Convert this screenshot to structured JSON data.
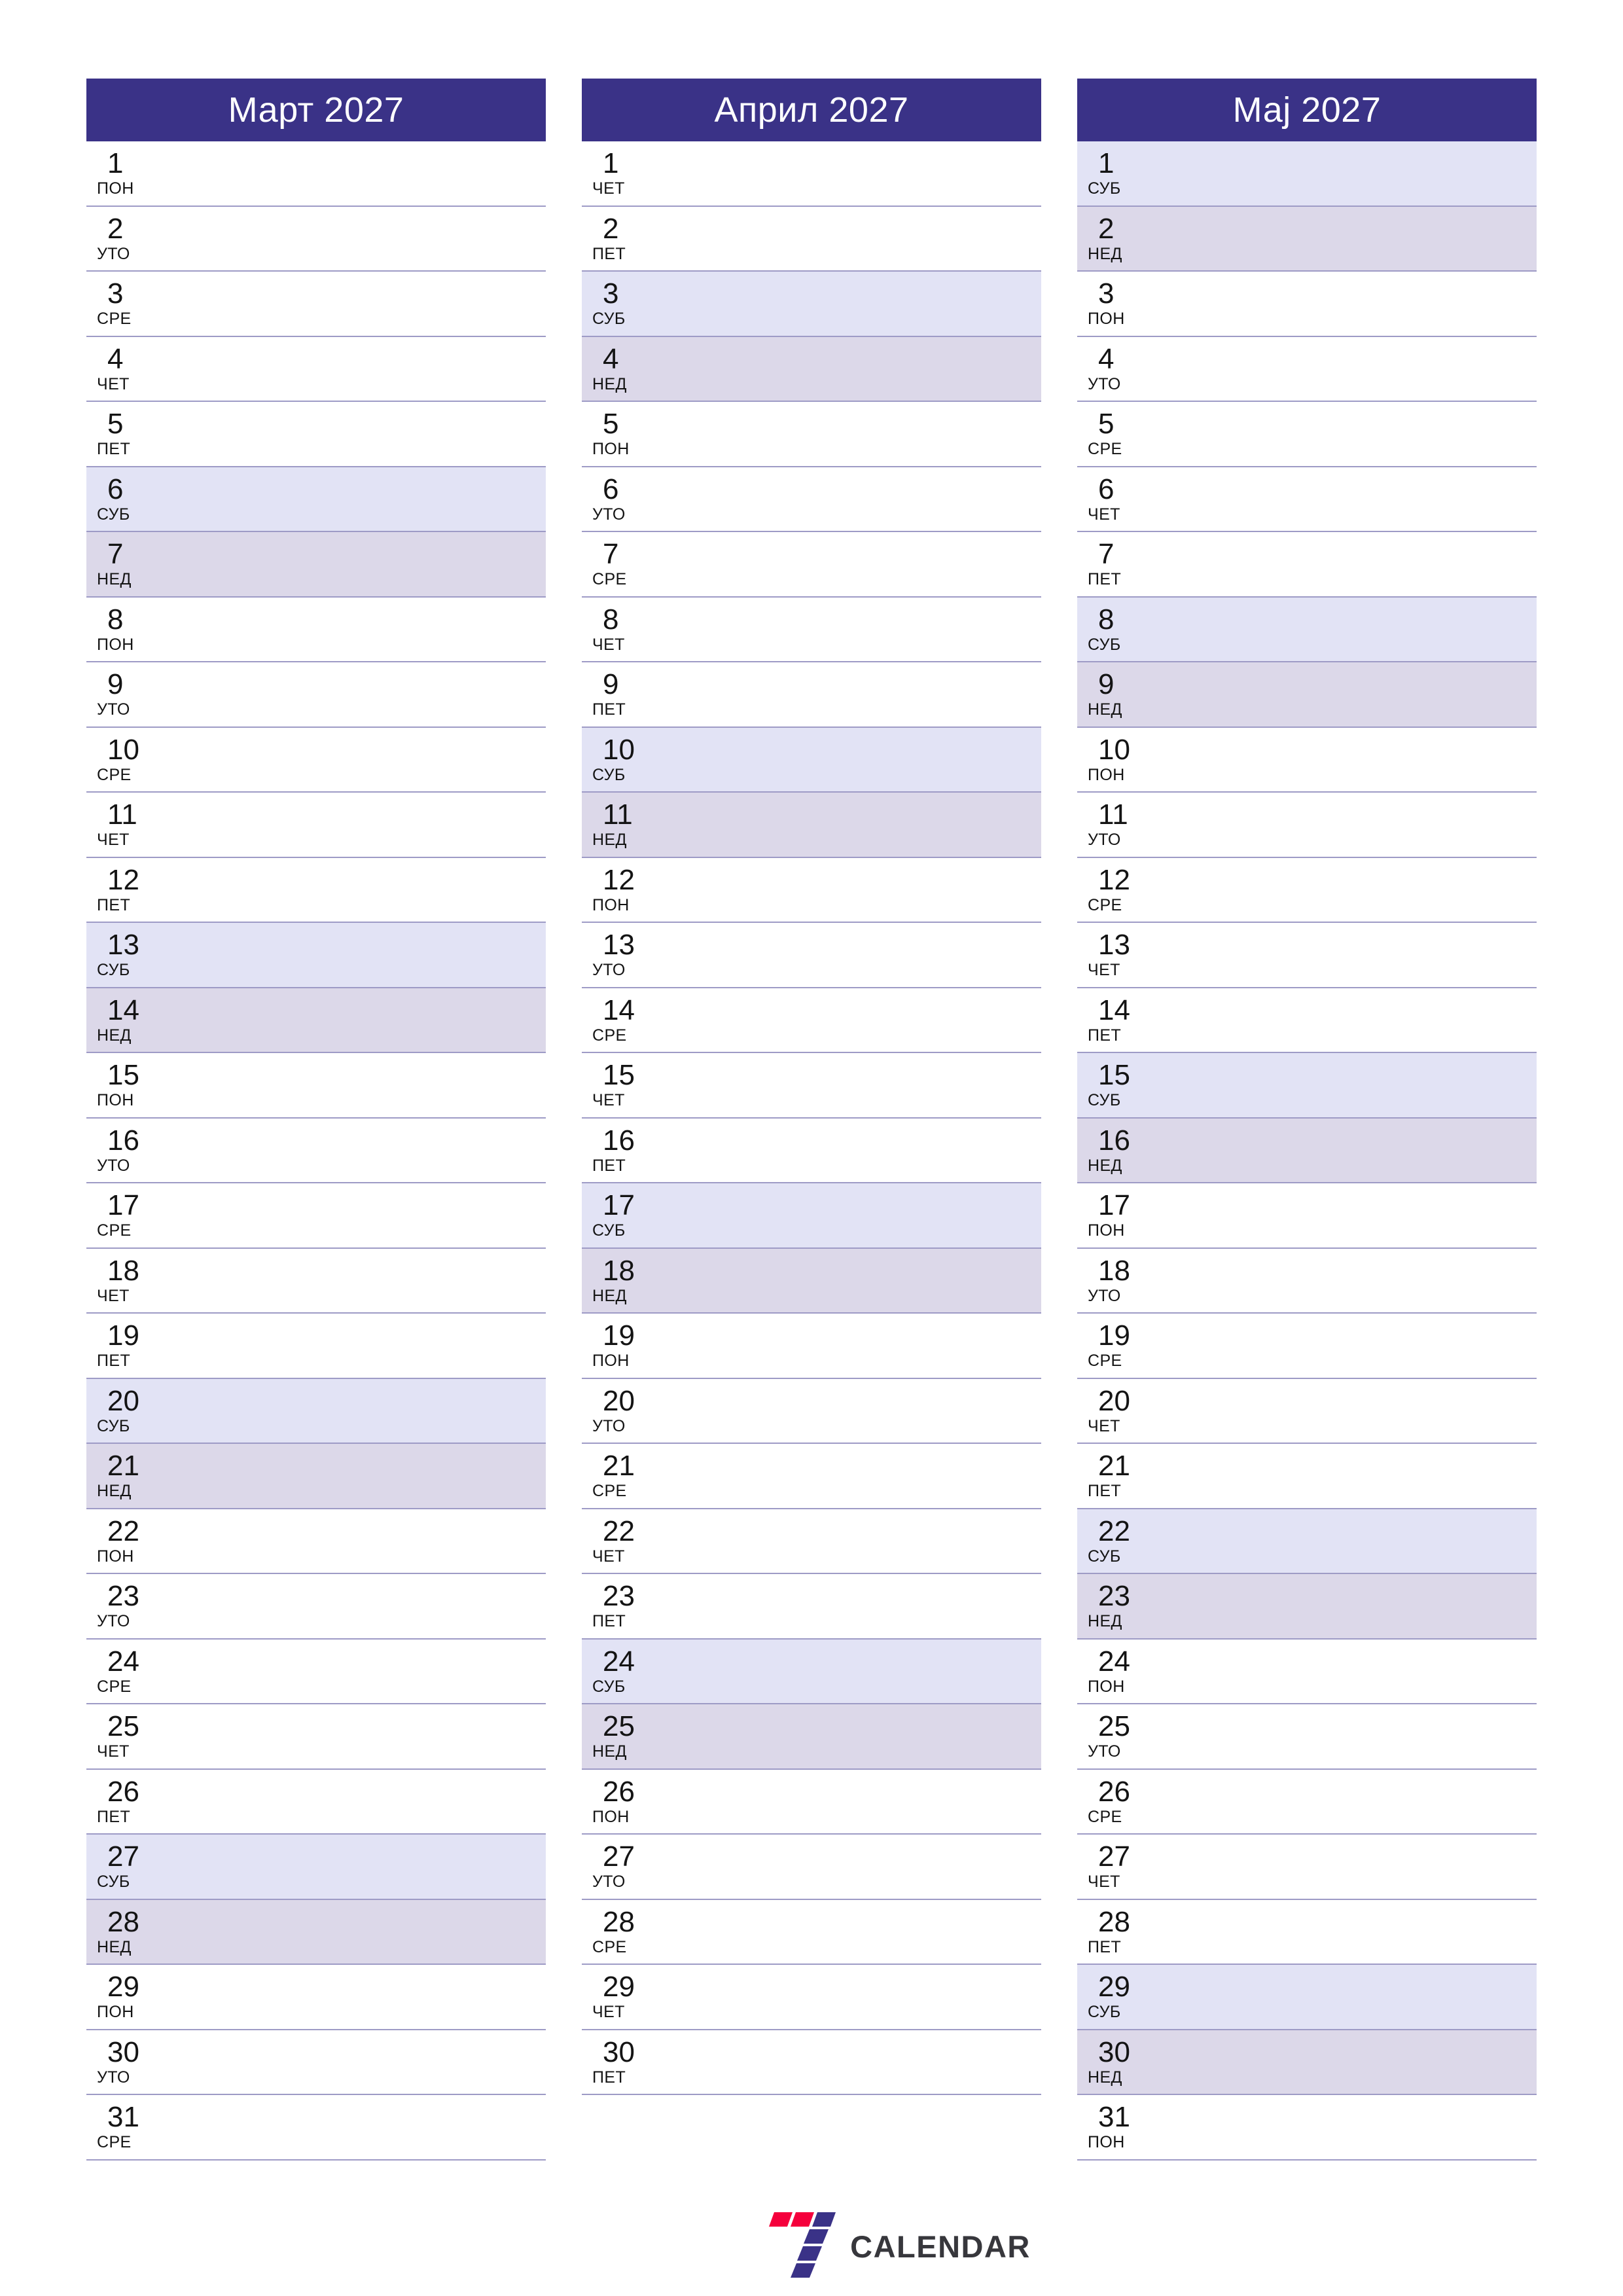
{
  "document": {
    "type": "printable-monthly-planner",
    "locale": "sr",
    "year": "2027"
  },
  "colors": {
    "header_bg": "#3a3287",
    "header_text": "#ffffff",
    "saturday_bg": "#e2e3f5",
    "sunday_bg": "#dcd8e9",
    "row_divider": "#9e9bc6",
    "page_bg": "#ffffff",
    "logo_red": "#f5003c",
    "logo_indigo": "#3a3287",
    "logo_text": "#37373c"
  },
  "logo": {
    "mark": "seven-bars-icon",
    "text": "CALENDAR"
  },
  "months": [
    {
      "id": "march",
      "title": "Март 2027",
      "days": [
        {
          "num": "1",
          "name": "ПОН",
          "type": "weekday"
        },
        {
          "num": "2",
          "name": "УТО",
          "type": "weekday"
        },
        {
          "num": "3",
          "name": "СРЕ",
          "type": "weekday"
        },
        {
          "num": "4",
          "name": "ЧЕТ",
          "type": "weekday"
        },
        {
          "num": "5",
          "name": "ПЕТ",
          "type": "weekday"
        },
        {
          "num": "6",
          "name": "СУБ",
          "type": "saturday"
        },
        {
          "num": "7",
          "name": "НЕД",
          "type": "sunday"
        },
        {
          "num": "8",
          "name": "ПОН",
          "type": "weekday"
        },
        {
          "num": "9",
          "name": "УТО",
          "type": "weekday"
        },
        {
          "num": "10",
          "name": "СРЕ",
          "type": "weekday"
        },
        {
          "num": "11",
          "name": "ЧЕТ",
          "type": "weekday"
        },
        {
          "num": "12",
          "name": "ПЕТ",
          "type": "weekday"
        },
        {
          "num": "13",
          "name": "СУБ",
          "type": "saturday"
        },
        {
          "num": "14",
          "name": "НЕД",
          "type": "sunday"
        },
        {
          "num": "15",
          "name": "ПОН",
          "type": "weekday"
        },
        {
          "num": "16",
          "name": "УТО",
          "type": "weekday"
        },
        {
          "num": "17",
          "name": "СРЕ",
          "type": "weekday"
        },
        {
          "num": "18",
          "name": "ЧЕТ",
          "type": "weekday"
        },
        {
          "num": "19",
          "name": "ПЕТ",
          "type": "weekday"
        },
        {
          "num": "20",
          "name": "СУБ",
          "type": "saturday"
        },
        {
          "num": "21",
          "name": "НЕД",
          "type": "sunday"
        },
        {
          "num": "22",
          "name": "ПОН",
          "type": "weekday"
        },
        {
          "num": "23",
          "name": "УТО",
          "type": "weekday"
        },
        {
          "num": "24",
          "name": "СРЕ",
          "type": "weekday"
        },
        {
          "num": "25",
          "name": "ЧЕТ",
          "type": "weekday"
        },
        {
          "num": "26",
          "name": "ПЕТ",
          "type": "weekday"
        },
        {
          "num": "27",
          "name": "СУБ",
          "type": "saturday"
        },
        {
          "num": "28",
          "name": "НЕД",
          "type": "sunday"
        },
        {
          "num": "29",
          "name": "ПОН",
          "type": "weekday"
        },
        {
          "num": "30",
          "name": "УТО",
          "type": "weekday"
        },
        {
          "num": "31",
          "name": "СРЕ",
          "type": "weekday"
        }
      ]
    },
    {
      "id": "april",
      "title": "Април 2027",
      "days": [
        {
          "num": "1",
          "name": "ЧЕТ",
          "type": "weekday"
        },
        {
          "num": "2",
          "name": "ПЕТ",
          "type": "weekday"
        },
        {
          "num": "3",
          "name": "СУБ",
          "type": "saturday"
        },
        {
          "num": "4",
          "name": "НЕД",
          "type": "sunday"
        },
        {
          "num": "5",
          "name": "ПОН",
          "type": "weekday"
        },
        {
          "num": "6",
          "name": "УТО",
          "type": "weekday"
        },
        {
          "num": "7",
          "name": "СРЕ",
          "type": "weekday"
        },
        {
          "num": "8",
          "name": "ЧЕТ",
          "type": "weekday"
        },
        {
          "num": "9",
          "name": "ПЕТ",
          "type": "weekday"
        },
        {
          "num": "10",
          "name": "СУБ",
          "type": "saturday"
        },
        {
          "num": "11",
          "name": "НЕД",
          "type": "sunday"
        },
        {
          "num": "12",
          "name": "ПОН",
          "type": "weekday"
        },
        {
          "num": "13",
          "name": "УТО",
          "type": "weekday"
        },
        {
          "num": "14",
          "name": "СРЕ",
          "type": "weekday"
        },
        {
          "num": "15",
          "name": "ЧЕТ",
          "type": "weekday"
        },
        {
          "num": "16",
          "name": "ПЕТ",
          "type": "weekday"
        },
        {
          "num": "17",
          "name": "СУБ",
          "type": "saturday"
        },
        {
          "num": "18",
          "name": "НЕД",
          "type": "sunday"
        },
        {
          "num": "19",
          "name": "ПОН",
          "type": "weekday"
        },
        {
          "num": "20",
          "name": "УТО",
          "type": "weekday"
        },
        {
          "num": "21",
          "name": "СРЕ",
          "type": "weekday"
        },
        {
          "num": "22",
          "name": "ЧЕТ",
          "type": "weekday"
        },
        {
          "num": "23",
          "name": "ПЕТ",
          "type": "weekday"
        },
        {
          "num": "24",
          "name": "СУБ",
          "type": "saturday"
        },
        {
          "num": "25",
          "name": "НЕД",
          "type": "sunday"
        },
        {
          "num": "26",
          "name": "ПОН",
          "type": "weekday"
        },
        {
          "num": "27",
          "name": "УТО",
          "type": "weekday"
        },
        {
          "num": "28",
          "name": "СРЕ",
          "type": "weekday"
        },
        {
          "num": "29",
          "name": "ЧЕТ",
          "type": "weekday"
        },
        {
          "num": "30",
          "name": "ПЕТ",
          "type": "weekday"
        }
      ]
    },
    {
      "id": "may",
      "title": "Мај 2027",
      "days": [
        {
          "num": "1",
          "name": "СУБ",
          "type": "saturday"
        },
        {
          "num": "2",
          "name": "НЕД",
          "type": "sunday"
        },
        {
          "num": "3",
          "name": "ПОН",
          "type": "weekday"
        },
        {
          "num": "4",
          "name": "УТО",
          "type": "weekday"
        },
        {
          "num": "5",
          "name": "СРЕ",
          "type": "weekday"
        },
        {
          "num": "6",
          "name": "ЧЕТ",
          "type": "weekday"
        },
        {
          "num": "7",
          "name": "ПЕТ",
          "type": "weekday"
        },
        {
          "num": "8",
          "name": "СУБ",
          "type": "saturday"
        },
        {
          "num": "9",
          "name": "НЕД",
          "type": "sunday"
        },
        {
          "num": "10",
          "name": "ПОН",
          "type": "weekday"
        },
        {
          "num": "11",
          "name": "УТО",
          "type": "weekday"
        },
        {
          "num": "12",
          "name": "СРЕ",
          "type": "weekday"
        },
        {
          "num": "13",
          "name": "ЧЕТ",
          "type": "weekday"
        },
        {
          "num": "14",
          "name": "ПЕТ",
          "type": "weekday"
        },
        {
          "num": "15",
          "name": "СУБ",
          "type": "saturday"
        },
        {
          "num": "16",
          "name": "НЕД",
          "type": "sunday"
        },
        {
          "num": "17",
          "name": "ПОН",
          "type": "weekday"
        },
        {
          "num": "18",
          "name": "УТО",
          "type": "weekday"
        },
        {
          "num": "19",
          "name": "СРЕ",
          "type": "weekday"
        },
        {
          "num": "20",
          "name": "ЧЕТ",
          "type": "weekday"
        },
        {
          "num": "21",
          "name": "ПЕТ",
          "type": "weekday"
        },
        {
          "num": "22",
          "name": "СУБ",
          "type": "saturday"
        },
        {
          "num": "23",
          "name": "НЕД",
          "type": "sunday"
        },
        {
          "num": "24",
          "name": "ПОН",
          "type": "weekday"
        },
        {
          "num": "25",
          "name": "УТО",
          "type": "weekday"
        },
        {
          "num": "26",
          "name": "СРЕ",
          "type": "weekday"
        },
        {
          "num": "27",
          "name": "ЧЕТ",
          "type": "weekday"
        },
        {
          "num": "28",
          "name": "ПЕТ",
          "type": "weekday"
        },
        {
          "num": "29",
          "name": "СУБ",
          "type": "saturday"
        },
        {
          "num": "30",
          "name": "НЕД",
          "type": "sunday"
        },
        {
          "num": "31",
          "name": "ПОН",
          "type": "weekday"
        }
      ]
    }
  ]
}
